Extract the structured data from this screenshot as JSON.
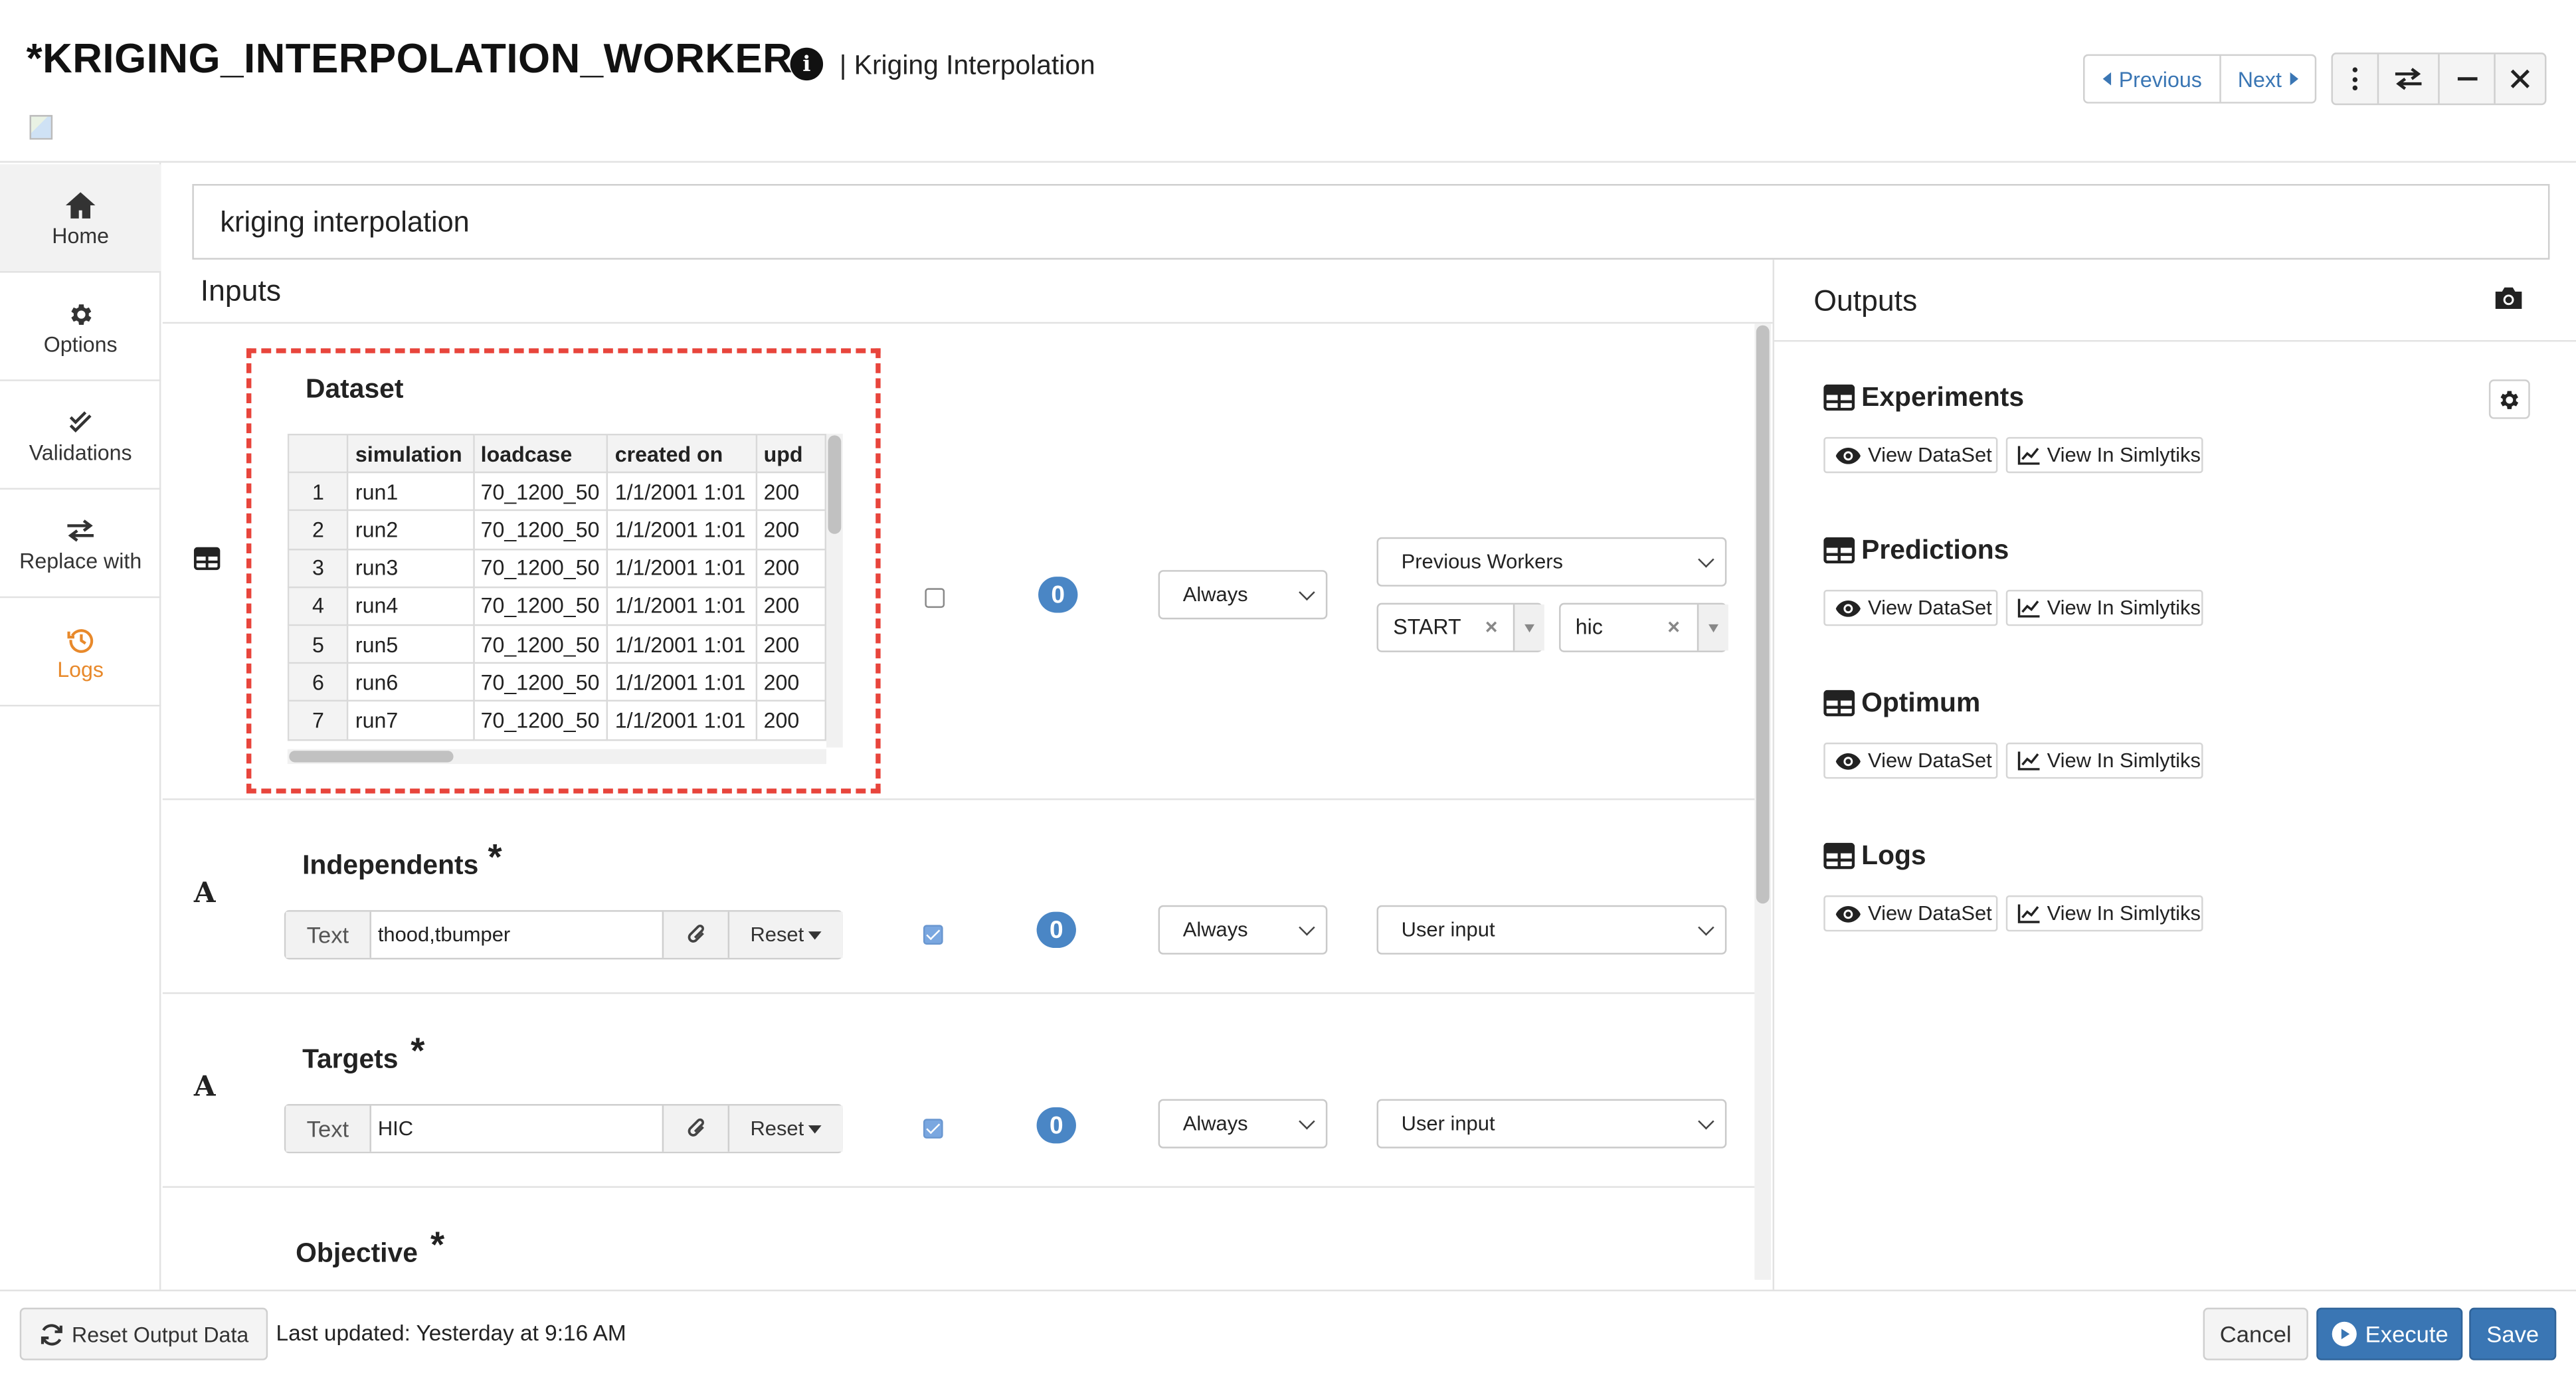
{
  "header": {
    "title": "*KRIGING_INTERPOLATION_WORKER",
    "subtitle": "| Kriging Interpolation",
    "prev_label": "Previous",
    "next_label": "Next"
  },
  "sidebar": {
    "items": [
      {
        "label": "Home",
        "icon": "home-icon"
      },
      {
        "label": "Options",
        "icon": "gear-icon"
      },
      {
        "label": "Validations",
        "icon": "double-check-icon"
      },
      {
        "label": "Replace with",
        "icon": "swap-icon"
      },
      {
        "label": "Logs",
        "icon": "history-icon"
      }
    ],
    "active_color": "#e8892b"
  },
  "description": "kriging interpolation",
  "inputs": {
    "heading": "Inputs",
    "dataset": {
      "label": "Dataset",
      "columns": [
        "simulation",
        "loadcase",
        "created on",
        "upd"
      ],
      "rows": [
        [
          "1",
          "run1",
          "70_1200_50",
          "1/1/2001 1:01",
          "200"
        ],
        [
          "2",
          "run2",
          "70_1200_50",
          "1/1/2001 1:01",
          "200"
        ],
        [
          "3",
          "run3",
          "70_1200_50",
          "1/1/2001 1:01",
          "200"
        ],
        [
          "4",
          "run4",
          "70_1200_50",
          "1/1/2001 1:01",
          "200"
        ],
        [
          "5",
          "run5",
          "70_1200_50",
          "1/1/2001 1:01",
          "200"
        ],
        [
          "6",
          "run6",
          "70_1200_50",
          "1/1/2001 1:01",
          "200"
        ],
        [
          "7",
          "run7",
          "70_1200_50",
          "1/1/2001 1:01",
          "200"
        ]
      ],
      "checked": false,
      "count": "0",
      "mode": "Always",
      "source": "Previous Workers",
      "tag1": "START",
      "tag2": "hic"
    },
    "independents": {
      "label": "Independents",
      "required": "*",
      "type_label": "Text",
      "value": "thood,tbumper",
      "reset_label": "Reset",
      "checked": true,
      "count": "0",
      "mode": "Always",
      "source": "User input"
    },
    "targets": {
      "label": "Targets",
      "required": "*",
      "type_label": "Text",
      "value": "HIC",
      "reset_label": "Reset",
      "checked": true,
      "count": "0",
      "mode": "Always",
      "source": "User input"
    },
    "objective": {
      "label": "Objective",
      "required": "*"
    }
  },
  "outputs": {
    "heading": "Outputs",
    "view_dataset_label": "View DataSet",
    "view_simlytiks_label": "View In Simlytiks",
    "items": [
      {
        "name": "Experiments"
      },
      {
        "name": "Predictions"
      },
      {
        "name": "Optimum"
      },
      {
        "name": "Logs"
      }
    ]
  },
  "footer": {
    "reset_output_label": "Reset Output Data",
    "last_updated": "Last updated: Yesterday at 9:16 AM",
    "cancel_label": "Cancel",
    "execute_label": "Execute",
    "save_label": "Save"
  },
  "colors": {
    "primary": "#3a76b4",
    "badge": "#4a86c5",
    "highlight_dash": "#e8453c"
  }
}
